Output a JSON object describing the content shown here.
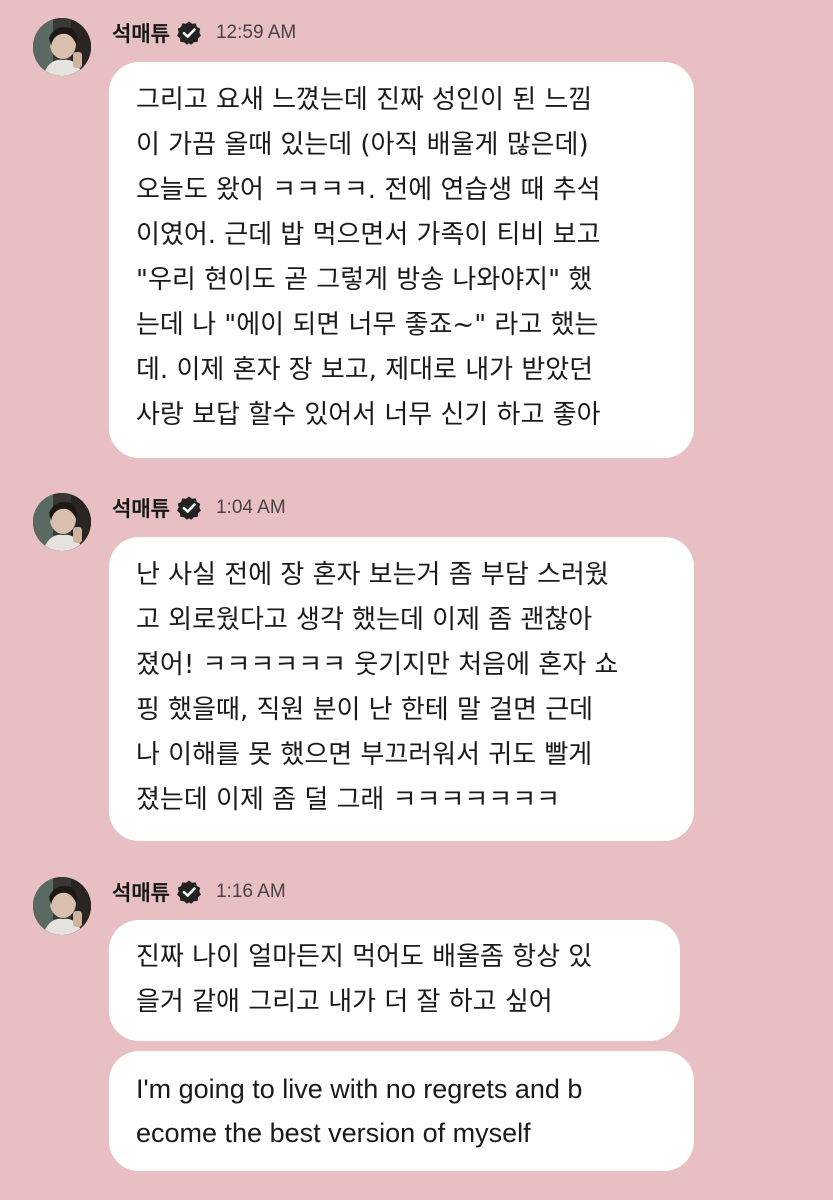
{
  "colors": {
    "background": "#e8c0c3",
    "bubble": "#ffffff",
    "text": "#1a1a1a",
    "timestamp": "#4a4346",
    "verified_badge": "#222222"
  },
  "messages": [
    {
      "sender": "석매튜",
      "verified_icon": "verified-badge-icon",
      "time": "12:59 AM",
      "bubbles": [
        {
          "lines": [
            "그리고 요새 느꼈는데 진짜 성인이 된 느낌",
            "이 가끔 올때 있는데 (아직 배울게 많은데)",
            "오늘도 왔어 ㅋㅋㅋㅋ. 전에 연습생 때 추석",
            "이였어. 근데 밥 먹으면서 가족이 티비 보고",
            "\"우리 현이도 곧 그렇게 방송 나와야지\" 했",
            "는데 나 \"에이 되면 너무 좋죠~\" 라고 했는",
            "데. 이제 혼자 장 보고, 제대로 내가 받았던",
            "사랑 보답 할수 있어서 너무 신기 하고 좋아"
          ]
        }
      ]
    },
    {
      "sender": "석매튜",
      "verified_icon": "verified-badge-icon",
      "time": "1:04 AM",
      "bubbles": [
        {
          "lines": [
            "난 사실 전에 장 혼자 보는거 좀 부담 스러웠",
            "고 외로웠다고 생각 했는데 이제 좀 괜찮아",
            "졌어! ㅋㅋㅋㅋㅋㅋ 웃기지만 처음에 혼자 쇼",
            "핑 했을때, 직원 분이 난 한테 말 걸면 근데",
            "나 이해를 못 했으면 부끄러워서 귀도 빨게",
            "졌는데 이제 좀 덜 그래 ㅋㅋㅋㅋㅋㅋㅋ"
          ]
        }
      ]
    },
    {
      "sender": "석매튜",
      "verified_icon": "verified-badge-icon",
      "time": "1:16 AM",
      "bubbles": [
        {
          "lines": [
            "진짜 나이 얼마든지 먹어도 배울좀 항상 있",
            "을거 같애 그리고 내가 더 잘 하고 싶어"
          ]
        },
        {
          "lines": [
            "I'm going to live with no regrets and b",
            "ecome the best version of myself"
          ]
        }
      ]
    }
  ]
}
